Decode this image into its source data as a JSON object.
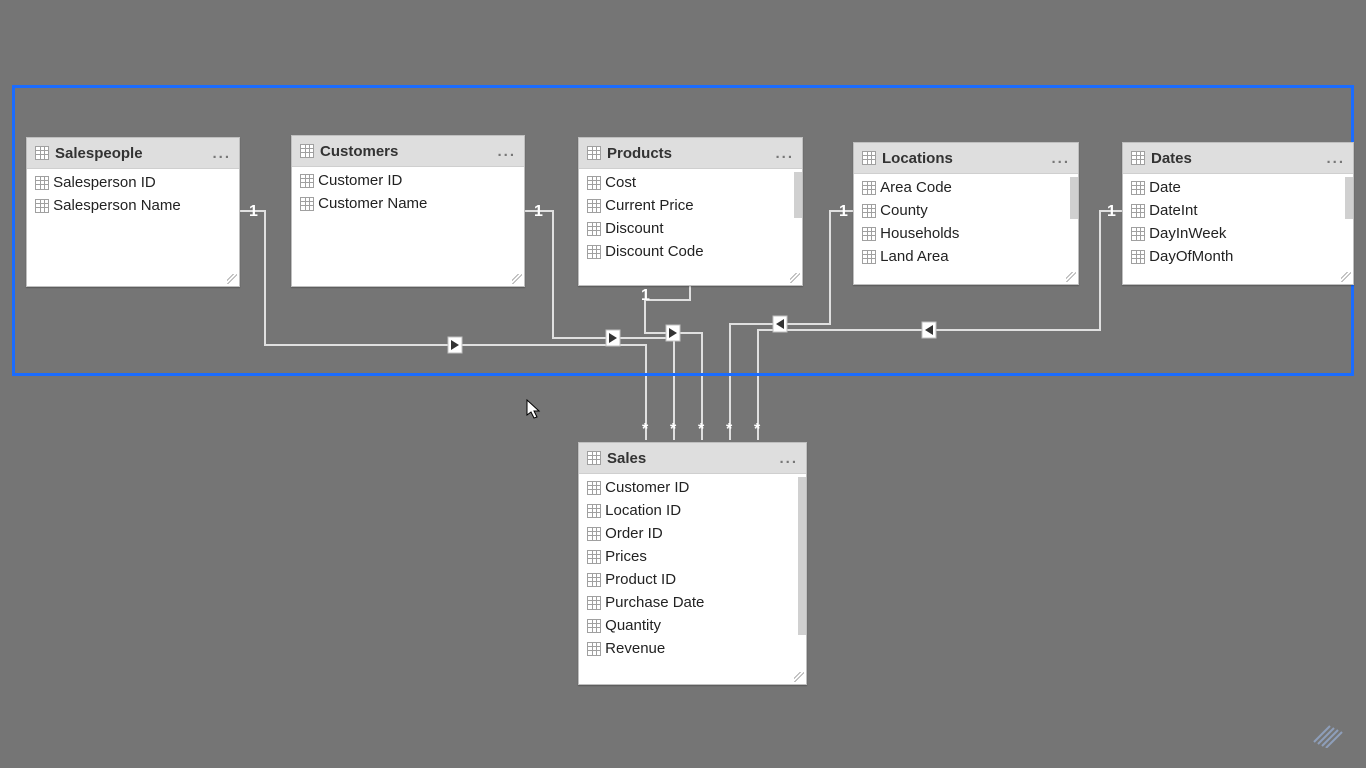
{
  "entities": {
    "salespeople": {
      "title": "Salespeople",
      "fields": [
        "Salesperson ID",
        "Salesperson Name"
      ]
    },
    "customers": {
      "title": "Customers",
      "fields": [
        "Customer ID",
        "Customer Name"
      ]
    },
    "products": {
      "title": "Products",
      "fields": [
        "Cost",
        "Current Price",
        "Discount",
        "Discount Code"
      ]
    },
    "locations": {
      "title": "Locations",
      "fields": [
        "Area Code",
        "County",
        "Households",
        "Land Area"
      ]
    },
    "dates": {
      "title": "Dates",
      "fields": [
        "Date",
        "DateInt",
        "DayInWeek",
        "DayOfMonth"
      ]
    },
    "sales": {
      "title": "Sales",
      "fields": [
        "Customer ID",
        "Location ID",
        "Order ID",
        "Prices",
        "Product ID",
        "Purchase Date",
        "Quantity",
        "Revenue"
      ]
    }
  },
  "cardinality": {
    "one": "1",
    "many": "*"
  },
  "menu_dots": "..."
}
